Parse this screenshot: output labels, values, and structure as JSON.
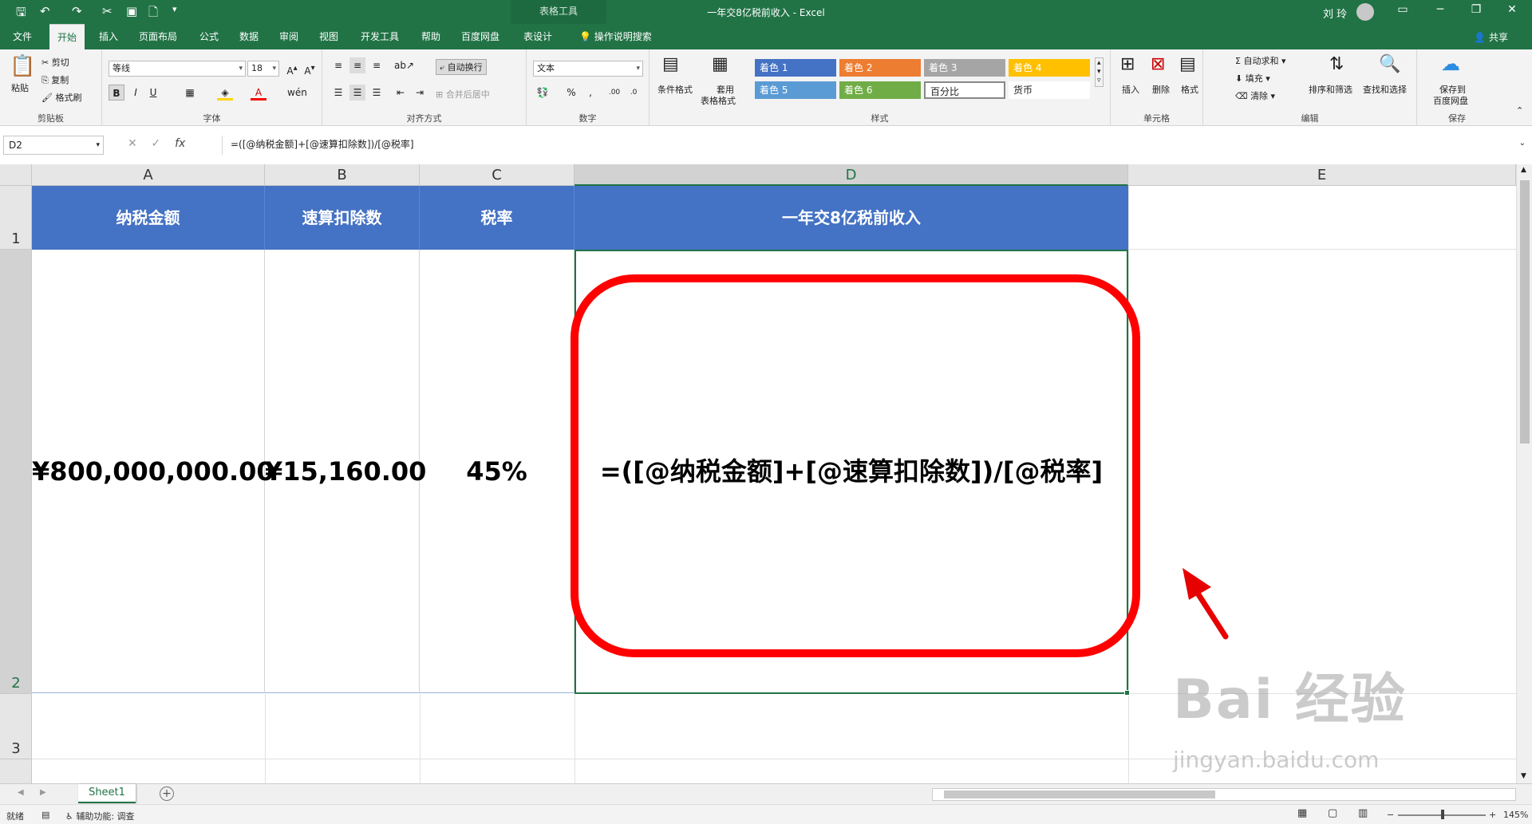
{
  "titlebar": {
    "context_tools": "表格工具",
    "document_title": "一年交8亿税前收入  -  Excel",
    "user": "刘 玲",
    "undo": "↶",
    "redo": "↷"
  },
  "tabs": [
    {
      "label": "文件"
    },
    {
      "label": "开始"
    },
    {
      "label": "插入"
    },
    {
      "label": "页面布局"
    },
    {
      "label": "公式"
    },
    {
      "label": "数据"
    },
    {
      "label": "审阅"
    },
    {
      "label": "视图"
    },
    {
      "label": "开发工具"
    },
    {
      "label": "帮助"
    },
    {
      "label": "百度网盘"
    },
    {
      "label": "表设计"
    }
  ],
  "tell_me": "操作说明搜索",
  "share": "共享",
  "ribbon": {
    "clipboard": {
      "paste": "粘贴",
      "cut": "剪切",
      "copy": "复制",
      "format_painter": "格式刷",
      "label": "剪贴板"
    },
    "font": {
      "name": "等线",
      "size": "18",
      "label": "字体",
      "bold": "B",
      "italic": "I",
      "underline": "U"
    },
    "alignment": {
      "wrap": "自动换行",
      "merge": "合并后居中",
      "label": "对齐方式"
    },
    "number": {
      "format": "文本",
      "percent": "%",
      "label": "数字"
    },
    "styles": {
      "conditional": "条件格式",
      "table_format_1": "套用",
      "table_format_2": "表格格式",
      "cells": [
        "着色 1",
        "着色 2",
        "着色 3",
        "着色 4",
        "着色 5",
        "着色 6",
        "百分比",
        "货币"
      ],
      "label": "样式"
    },
    "cells": {
      "insert": "插入",
      "delete": "删除",
      "format": "格式",
      "label": "单元格"
    },
    "editing": {
      "autosum": "自动求和",
      "fill": "填充",
      "clear": "清除",
      "sort": "排序和筛选",
      "find": "查找和选择",
      "label": "编辑"
    },
    "save": {
      "save_1": "保存到",
      "save_2": "百度网盘",
      "label": "保存"
    }
  },
  "formula_bar": {
    "name_box": "D2",
    "fx": "fx",
    "formula": "=([@纳税金额]+[@速算扣除数])/[@税率]"
  },
  "sheet": {
    "columns": [
      "A",
      "B",
      "C",
      "D",
      "E"
    ],
    "rows": [
      "1",
      "2",
      "3"
    ],
    "headers": {
      "a": "纳税金额",
      "b": "速算扣除数",
      "c": "税率",
      "d": "一年交8亿税前收入"
    },
    "values": {
      "a2": "¥800,000,000.00",
      "b2": "¥15,160.00",
      "c2": "45%",
      "d2": "=([@纳税金额]+[@速算扣除数])/[@税率]"
    }
  },
  "sheet_tabs": [
    "Sheet1"
  ],
  "status": {
    "ready": "就绪",
    "accessibility": "辅助功能: 调查",
    "zoom": "145%"
  },
  "watermark": {
    "line1": "Bai 经验",
    "line2": "jingyan.baidu.com"
  },
  "colors": {
    "excel_green": "#217346",
    "header_blue": "#4472c4",
    "highlight_red": "#ff0000"
  }
}
